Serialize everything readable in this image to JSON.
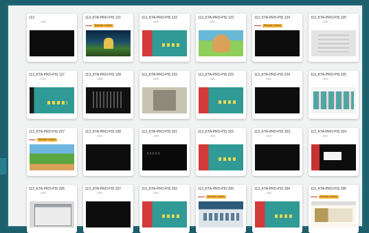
{
  "colors": {
    "background": "#1e5f6c",
    "frame_border": "#1f6877",
    "frame_fill": "#f1f3f3",
    "badge": "#f3b33d"
  },
  "cards": [
    {
      "title": "113",
      "sub": "1920",
      "badge": "",
      "thumb": "t-black"
    },
    {
      "title": "113_KTA-PRO-PIS 121",
      "sub": "",
      "badge": "Remote Control",
      "thumb": "t-game"
    },
    {
      "title": "113_KTA-PRO-PIS 122",
      "sub": "1920",
      "badge": "",
      "thumb": "t-split"
    },
    {
      "title": "113_KTA-PRO-PIS 123",
      "sub": "1920",
      "badge": "",
      "thumb": "t-cartoon"
    },
    {
      "title": "113_KTA-PRO-PIS 124",
      "sub": "",
      "badge": "Remote Control",
      "thumb": "t-black"
    },
    {
      "title": "113_KTA-PRO-PIS 125",
      "sub": "1920",
      "badge": "",
      "thumb": "t-gray"
    },
    {
      "title": "113_KTA-PRO-PIS 127",
      "sub": "1920",
      "badge": "",
      "thumb": "t-teal"
    },
    {
      "title": "113_KTA-PRO-PIS 128",
      "sub": "1458",
      "badge": "",
      "thumb": "t-dark-grid"
    },
    {
      "title": "113_KTA-PRO-PIS 222",
      "sub": "1920",
      "badge": "",
      "thumb": "t-panel"
    },
    {
      "title": "113_KTA-PRO-PIS 223",
      "sub": "1920",
      "badge": "",
      "thumb": "t-split"
    },
    {
      "title": "113_KTA-PRO-PIS 224",
      "sub": "1920",
      "badge": "",
      "thumb": "t-black"
    },
    {
      "title": "113_KTA-PRO-PIS 225",
      "sub": "1920",
      "badge": "",
      "thumb": "t-pink-tiles"
    },
    {
      "title": "113_KTA-PRO-PIS 227",
      "sub": "",
      "badge": "Remote Control",
      "thumb": "t-landscape"
    },
    {
      "title": "113_KTA-PRO-PIS 228",
      "sub": "1920",
      "badge": "",
      "thumb": "t-black"
    },
    {
      "title": "113_KTA-PRO-PIS 321",
      "sub": "1920",
      "badge": "",
      "thumb": "t-black-dots"
    },
    {
      "title": "113_KTA-PRO-PIS 322",
      "sub": "1920",
      "badge": "",
      "thumb": "t-split"
    },
    {
      "title": "113_KTA-PRO-PIS 323",
      "sub": "1920",
      "badge": "",
      "thumb": "t-black"
    },
    {
      "title": "113_KTA-PRO-PIS 324",
      "sub": "1924",
      "badge": "",
      "thumb": "t-red-block"
    },
    {
      "title": "113_KTA-PRO-PIS 326",
      "sub": "1920",
      "badge": "",
      "thumb": "t-dialog"
    },
    {
      "title": "113_KTA-PRO-PIS 327",
      "sub": "1920",
      "badge": "",
      "thumb": "t-black"
    },
    {
      "title": "113_KTA-PRO-PIS 332",
      "sub": "1920",
      "badge": "",
      "thumb": "t-split"
    },
    {
      "title": "113_KTA-PRO-PIS 333",
      "sub": "",
      "badge": "Remote Control",
      "thumb": "t-screen"
    },
    {
      "title": "113_KTA-PRO-PIS 334",
      "sub": "1364",
      "badge": "",
      "thumb": "t-split"
    },
    {
      "title": "113_KTA-PRO-PIS 335",
      "sub": "",
      "badge": "Remote Control",
      "thumb": "t-site"
    }
  ]
}
